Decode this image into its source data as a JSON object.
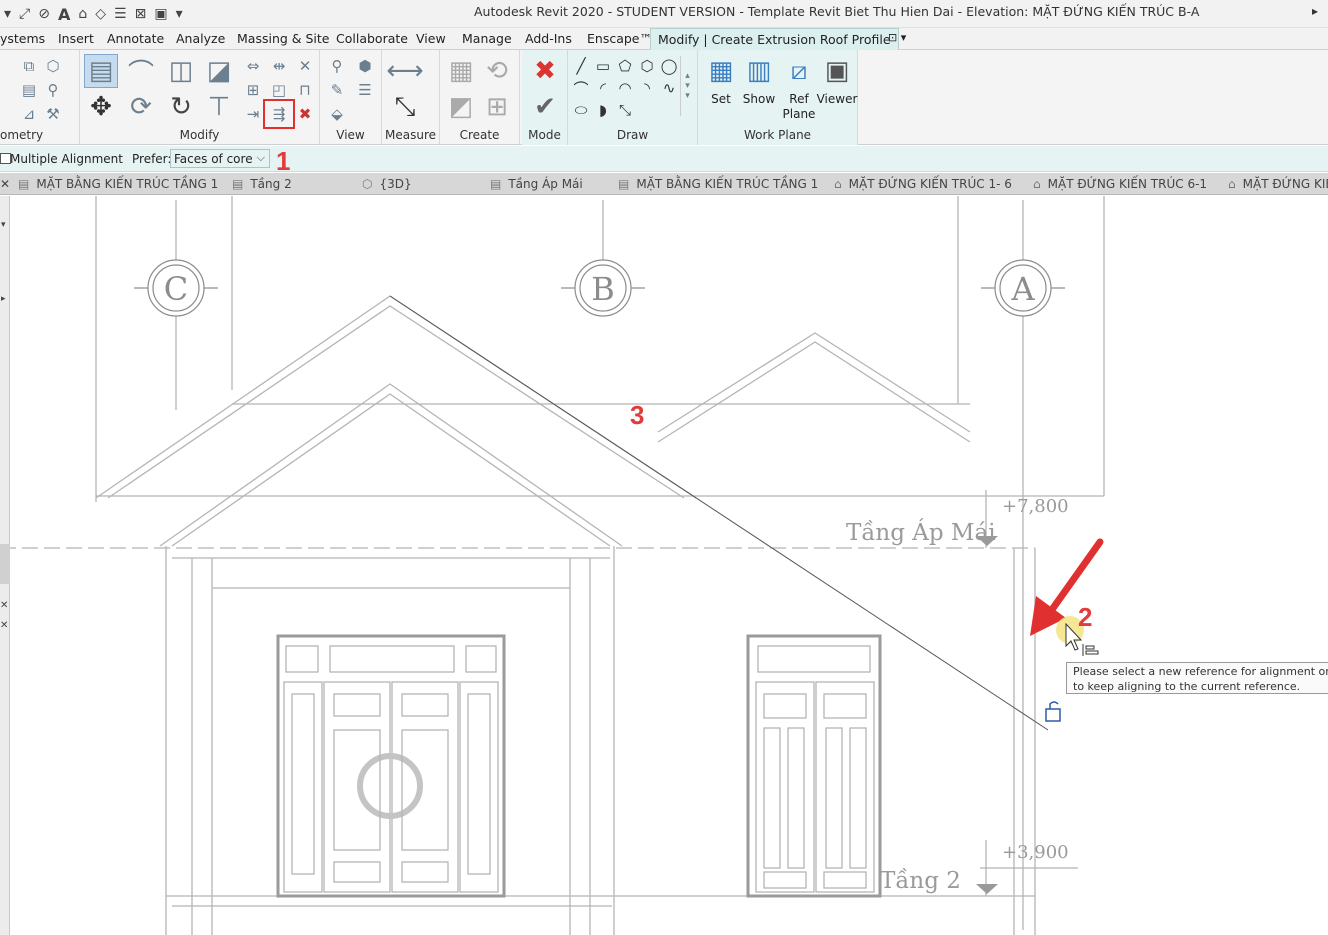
{
  "window": {
    "title": "Autodesk Revit 2020 - STUDENT VERSION - Template Revit Biet Thu Hien Dai - Elevation: MẶT ĐỨNG KIẾN TRÚC B-A",
    "restore_glyph": "▸"
  },
  "menu": {
    "tabs": [
      {
        "label": "ystems"
      },
      {
        "label": "Insert"
      },
      {
        "label": "Annotate"
      },
      {
        "label": "Analyze"
      },
      {
        "label": "Massing & Site"
      },
      {
        "label": "Collaborate"
      },
      {
        "label": "View"
      },
      {
        "label": "Manage"
      },
      {
        "label": "Add-Ins"
      },
      {
        "label": "Enscape™"
      },
      {
        "label": "Modify | Create Extrusion Roof Profile"
      }
    ]
  },
  "ribbon": {
    "panels": {
      "geometry": "ometry",
      "modify": "Modify",
      "view": "View",
      "measure": "Measure",
      "create": "Create",
      "mode": "Mode",
      "draw": "Draw",
      "work_plane": "Work Plane"
    },
    "work_plane_tools": {
      "set": "Set",
      "show": "Show",
      "ref_plane_1": "Ref",
      "ref_plane_2": "Plane",
      "viewer": "Viewer"
    }
  },
  "options": {
    "multiple_alignment": "Multiple Alignment",
    "prefer_label": "Prefer:",
    "prefer_value": "Faces of core"
  },
  "view_tabs": [
    {
      "label": "MẶT BẰNG KIẾN TRÚC TẦNG 1"
    },
    {
      "label": "Tầng 2"
    },
    {
      "label": "{3D}"
    },
    {
      "label": "Tầng Áp Mái"
    },
    {
      "label": "MẶT BẰNG KIẾN TRÚC TẦNG 1"
    },
    {
      "label": "MẶT ĐỨNG KIẾN TRÚC 1- 6"
    },
    {
      "label": "MẶT ĐỨNG KIẾN TRÚC 6-1"
    },
    {
      "label": "MẶT ĐỨNG KIẾN"
    }
  ],
  "drawing": {
    "grids": [
      "C",
      "B",
      "A"
    ],
    "levels": [
      {
        "name": "Tầng Áp Mái",
        "elevation": "+7,800"
      },
      {
        "name": "Tầng 2",
        "elevation": "+3,900"
      }
    ]
  },
  "tooltip": {
    "line1": "Please select a new reference for alignment or Ctrl",
    "line2": "to keep aligning to the current reference."
  },
  "annotations": {
    "step1": "1",
    "step2": "2",
    "step3": "3"
  },
  "colors": {
    "accent": "#e03030",
    "context_tab": "#dcefef"
  }
}
